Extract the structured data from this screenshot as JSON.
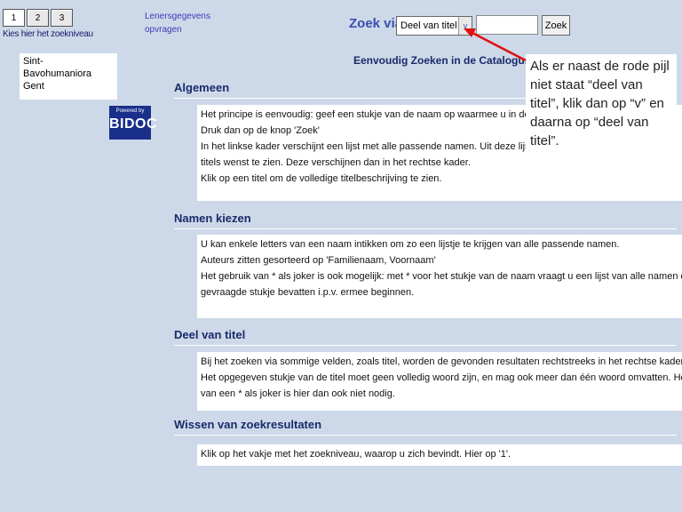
{
  "levels": {
    "buttons": [
      "1",
      "2",
      "3"
    ],
    "caption": "Kies hier het zoekniveau"
  },
  "lenersgegevens": "Lenersgegevens opvragen",
  "school": {
    "line1": "Sint-",
    "line2": "Bavohumaniora",
    "line3": "Gent"
  },
  "logo": {
    "powered": "Powered by",
    "name": "BIDOC"
  },
  "search": {
    "label": "Zoek via:",
    "selected": "Deel van titel",
    "arrow": "v",
    "button": "Zoek"
  },
  "page_title": "Eenvoudig Zoeken in de Catalogus",
  "sections": [
    {
      "heading": "Algemeen",
      "lines": [
        "Het principe is eenvoudig: geef een stukje van de naam op waarmee u in de catal",
        "Druk dan op de knop 'Zoek'",
        "In het linkse kader verschijnt een lijst met alle passende namen. Uit deze lijst kiest",
        "titels wenst te zien. Deze verschijnen dan in het rechtse kader.",
        "Klik op een titel om de volledige titelbeschrijving te zien."
      ]
    },
    {
      "heading": "Namen kiezen",
      "lines": [
        "U kan enkele letters van een naam intikken om zo een lijstje te krijgen van alle passende namen.",
        "Auteurs zitten gesorteerd op 'Familienaam, Voornaam'",
        "Het gebruik van * als joker is ook mogelijk: met * voor het stukje van de naam vraagt u een lijst van alle namen die het",
        "gevraagde stukje bevatten i.p.v. ermee beginnen."
      ]
    },
    {
      "heading": "Deel van titel",
      "lines": [
        "Bij het zoeken via sommige velden, zoals titel, worden de gevonden resultaten rechtstreeks in het rechtse kader getoond.",
        "Het opgegeven stukje van de titel moet geen volledig woord zijn, en mag ook meer dan één woord omvatten. Het gebruik",
        "van een * als joker is hier dan ook niet nodig."
      ]
    },
    {
      "heading": "Wissen van zoekresultaten",
      "lines": [
        "Klik op het vakje met het zoekniveau, waarop u zich bevindt. Hier op '1'."
      ]
    }
  ],
  "callout": "Als er naast de rode pijl niet staat “deel van titel”, klik dan op “v” en daarna op “deel van titel”.",
  "colors": {
    "background": "#cdd9e8",
    "heading": "#1a2a6a",
    "accent": "#3b4fb0",
    "arrow": "#e01010"
  }
}
